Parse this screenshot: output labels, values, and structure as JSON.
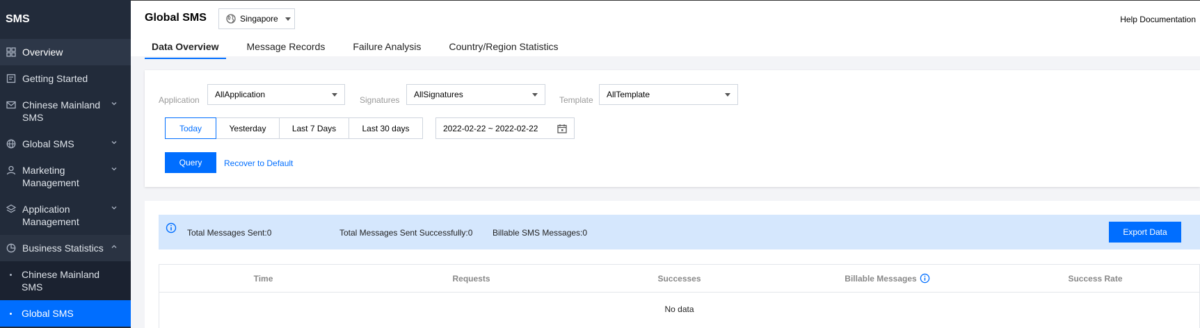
{
  "sidebar": {
    "brand": "SMS",
    "items": [
      {
        "label": "Overview",
        "icon": "grid-icon"
      },
      {
        "label": "Getting Started",
        "icon": "document-icon"
      },
      {
        "label": "Chinese Mainland SMS",
        "icon": "mail-icon"
      },
      {
        "label": "Global SMS",
        "icon": "globe-icon"
      },
      {
        "label": "Marketing Management",
        "icon": "user-icon"
      },
      {
        "label": "Application Management",
        "icon": "layers-icon"
      },
      {
        "label": "Business Statistics",
        "icon": "pie-chart-icon"
      }
    ],
    "sub_items": [
      {
        "label": "Chinese Mainland SMS"
      },
      {
        "label": "Global SMS"
      }
    ]
  },
  "header": {
    "title": "Global SMS",
    "region": "Singapore",
    "help": "Help Documentation",
    "tabs": [
      {
        "label": "Data Overview"
      },
      {
        "label": "Message Records"
      },
      {
        "label": "Failure Analysis"
      },
      {
        "label": "Country/Region Statistics"
      }
    ]
  },
  "filters": {
    "application_label": "Application",
    "application_value": "AllApplication",
    "signatures_label": "Signatures",
    "signatures_value": "AllSignatures",
    "template_label": "Template",
    "template_value": "AllTemplate",
    "date_buttons": [
      {
        "label": "Today"
      },
      {
        "label": "Yesterday"
      },
      {
        "label": "Last 7 Days"
      },
      {
        "label": "Last 30 days"
      }
    ],
    "date_range": "2022-02-22 ~ 2022-02-22",
    "query": "Query",
    "reset": "Recover to Default"
  },
  "summary": {
    "total_sent": "Total Messages Sent:0",
    "total_success": "Total Messages Sent Successfully:0",
    "billable": "Billable SMS Messages:0",
    "export": "Export Data"
  },
  "table": {
    "columns": [
      "Time",
      "Requests",
      "Successes",
      "Billable Messages",
      "Success Rate"
    ],
    "empty": "No data"
  },
  "colors": {
    "sidebar_bg": "#222b3a",
    "accent": "#006eff",
    "summary_bg": "#d5e7fd"
  }
}
